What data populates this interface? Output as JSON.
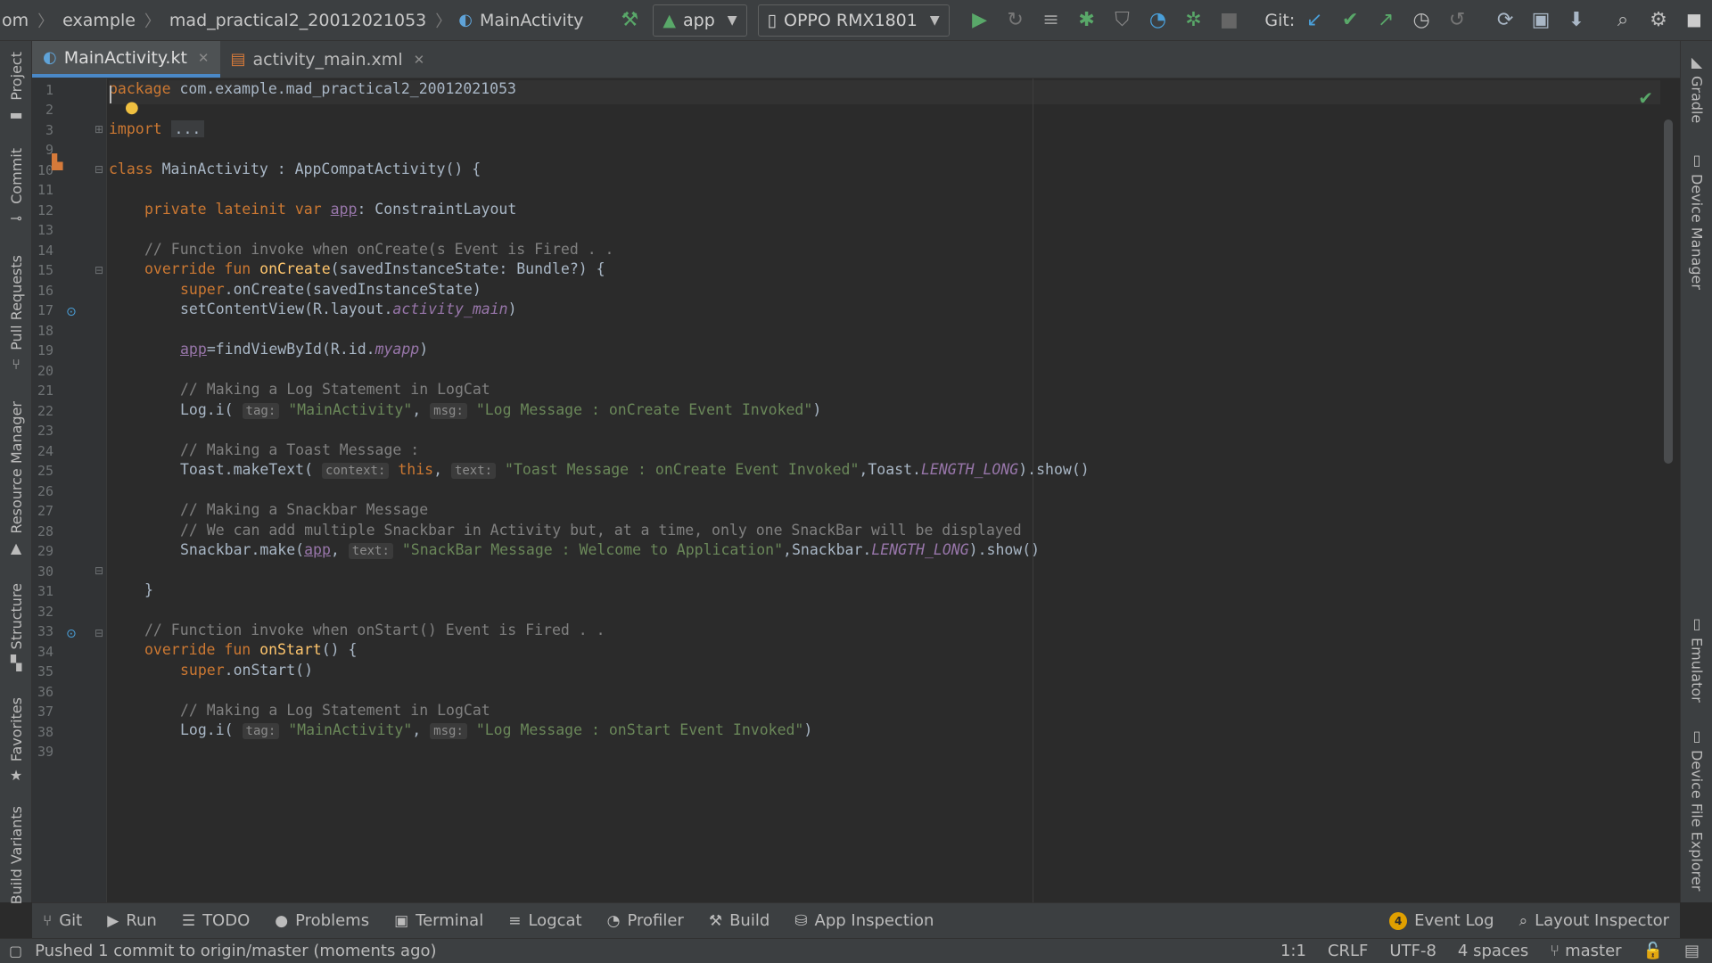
{
  "toolbar": {
    "breadcrumbs": [
      "om",
      "example",
      "mad_practical2_20012021053",
      "MainActivity"
    ],
    "run_config": "app",
    "device": "OPPO RMX1801",
    "git_label": "Git:"
  },
  "left_tools": [
    {
      "label": "Project",
      "icon": "folder-icon"
    },
    {
      "label": "Commit",
      "icon": "commit-icon"
    },
    {
      "label": "Pull Requests",
      "icon": "pull-request-icon"
    },
    {
      "label": "Resource Manager",
      "icon": "resource-icon"
    },
    {
      "label": "Structure",
      "icon": "structure-icon"
    },
    {
      "label": "Favorites",
      "icon": "star-icon"
    },
    {
      "label": "Build Variants",
      "icon": "build-variants-icon"
    }
  ],
  "right_tools": [
    {
      "label": "Gradle",
      "icon": "gradle-icon"
    },
    {
      "label": "Device Manager",
      "icon": "device-manager-icon"
    },
    {
      "label": "Emulator",
      "icon": "emulator-icon"
    },
    {
      "label": "Device File Explorer",
      "icon": "device-file-icon"
    }
  ],
  "tabs": [
    {
      "label": "MainActivity.kt",
      "active": true
    },
    {
      "label": "activity_main.xml",
      "active": false
    }
  ],
  "code": {
    "line_numbers": [
      "1",
      "2",
      "3",
      "9",
      "10",
      "11",
      "12",
      "13",
      "14",
      "15",
      "16",
      "17",
      "18",
      "19",
      "20",
      "21",
      "22",
      "23",
      "24",
      "25",
      "26",
      "27",
      "28",
      "29",
      "30",
      "31",
      "32",
      "33",
      "34",
      "35",
      "36",
      "37",
      "38",
      "39"
    ],
    "l1_kw": "package",
    "l1_rest": " com.example.mad_practical2_20012021053",
    "l3_kw": "import",
    "l3_fold": "...",
    "l10_kw": "class",
    "l10_rest": " MainActivity : AppCompatActivity() {",
    "l12_kw": "private lateinit var",
    "l12_prop": "app",
    "l12_rest": ": ConstraintLayout",
    "l14_cmt": "// Function invoke when onCreate(s Event is Fired . .",
    "l15_kw": "override fun",
    "l15_fn": "onCreate",
    "l15_rest": "(savedInstanceState: Bundle?) {",
    "l16_kw": "super",
    "l16_rest": ".onCreate(savedInstanceState)",
    "l17_pre": "setContentView(R.layout.",
    "l17_it": "activity_main",
    "l17_post": ")",
    "l19_prop": "app",
    "l19_pre": "=findViewById(R.id.",
    "l19_it": "myapp",
    "l19_post": ")",
    "l21_cmt": "// Making a Log Statement in LogCat",
    "l22_pre": "Log.i(",
    "l22_hint1": "tag:",
    "l22_str1": "\"MainActivity\"",
    "l22_comma": ", ",
    "l22_hint2": "msg:",
    "l22_str2": "\"Log Message : onCreate Event Invoked\"",
    "l22_post": ")",
    "l24_cmt": "// Making a Toast Message :",
    "l25_pre": "Toast.makeText(",
    "l25_hint1": "context:",
    "l25_kw": "this",
    "l25_comma": ", ",
    "l25_hint2": "text:",
    "l25_str": "\"Toast Message : onCreate Event Invoked\"",
    "l25_mid": ",Toast.",
    "l25_it": "LENGTH_LONG",
    "l25_post": ").show()",
    "l27_cmt": "// Making a Snackbar Message",
    "l28_cmt": "// We can add multiple Snackbar in Activity but, at a time, only one SnackBar will be displayed",
    "l29_pre": "Snackbar.make(",
    "l29_prop": "app",
    "l29_comma": ", ",
    "l29_hint": "text:",
    "l29_str": "\"SnackBar Message : Welcome to Application\"",
    "l29_mid": ",Snackbar.",
    "l29_it": "LENGTH_LONG",
    "l29_post": ").show()",
    "l31_text": "}",
    "l33_cmt": "// Function invoke when onStart() Event is Fired . .",
    "l34_kw": "override fun",
    "l34_fn": "onStart",
    "l34_rest": "() {",
    "l35_kw": "super",
    "l35_rest": ".onStart()",
    "l37_cmt": "// Making a Log Statement in LogCat",
    "l38_pre": "Log.i(",
    "l38_hint1": "tag:",
    "l38_str1": "\"MainActivity\"",
    "l38_comma": ", ",
    "l38_hint2": "msg:",
    "l38_str2": "\"Log Message : onStart Event Invoked\"",
    "l38_post": ")"
  },
  "bottom_tools": [
    {
      "label": "Git",
      "icon": "git-branch-icon"
    },
    {
      "label": "Run",
      "icon": "run-icon"
    },
    {
      "label": "TODO",
      "icon": "list-icon"
    },
    {
      "label": "Problems",
      "icon": "info-icon"
    },
    {
      "label": "Terminal",
      "icon": "terminal-icon"
    },
    {
      "label": "Logcat",
      "icon": "logcat-icon"
    },
    {
      "label": "Profiler",
      "icon": "gauge-icon"
    },
    {
      "label": "Build",
      "icon": "hammer-icon"
    },
    {
      "label": "App Inspection",
      "icon": "inspection-icon"
    }
  ],
  "bottom_right": {
    "event_log": "Event Log",
    "event_count": "4",
    "layout_inspector": "Layout Inspector"
  },
  "status": {
    "message": "Pushed 1 commit to origin/master (moments ago)",
    "position": "1:1",
    "line_sep": "CRLF",
    "encoding": "UTF-8",
    "indent": "4 spaces",
    "branch": "master"
  },
  "colors": {
    "keyword": "#cc7832",
    "comment": "#808080",
    "string": "#6a8759",
    "function": "#ffc66d",
    "constant": "#9876aa",
    "accent": "#4a88c7"
  }
}
